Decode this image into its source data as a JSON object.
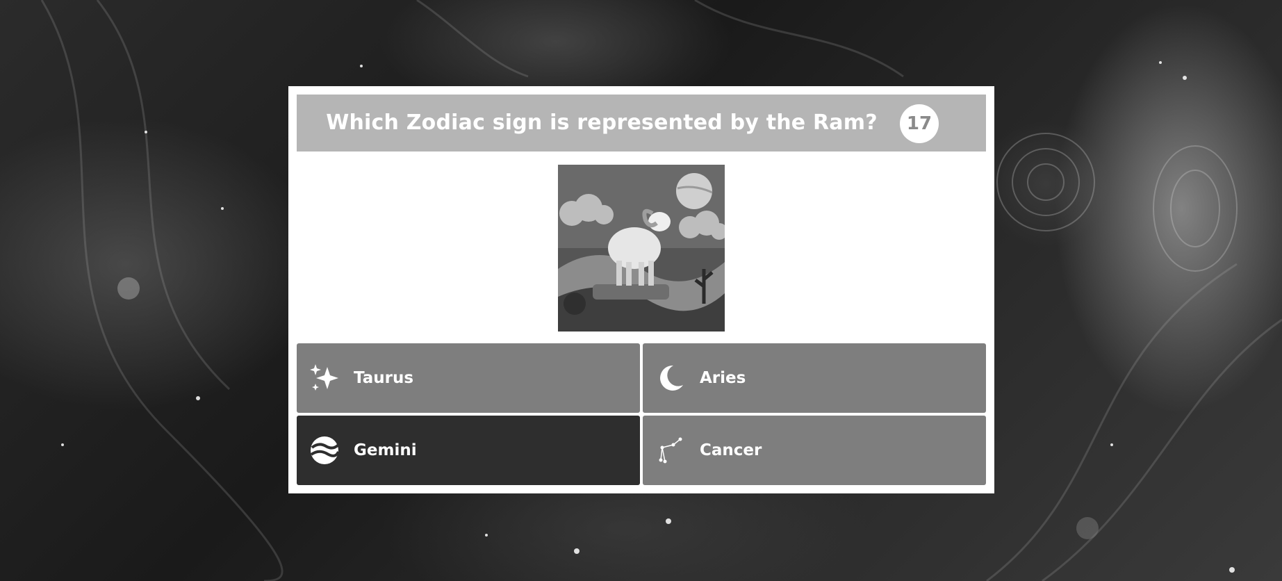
{
  "question": {
    "text": "Which Zodiac sign is represented by the Ram?",
    "timer": "17"
  },
  "image": {
    "subject": "ram-illustration"
  },
  "answers": [
    {
      "label": "Taurus",
      "icon": "sparkles-icon",
      "selected": false
    },
    {
      "label": "Aries",
      "icon": "crescent-moon-icon",
      "selected": false
    },
    {
      "label": "Gemini",
      "icon": "planet-icon",
      "selected": true
    },
    {
      "label": "Cancer",
      "icon": "constellation-icon",
      "selected": false
    }
  ],
  "colors": {
    "question_bar": "#b5b5b5",
    "answer_default": "#7e7e7e",
    "answer_selected": "#2e2e2e",
    "card": "#ffffff"
  }
}
